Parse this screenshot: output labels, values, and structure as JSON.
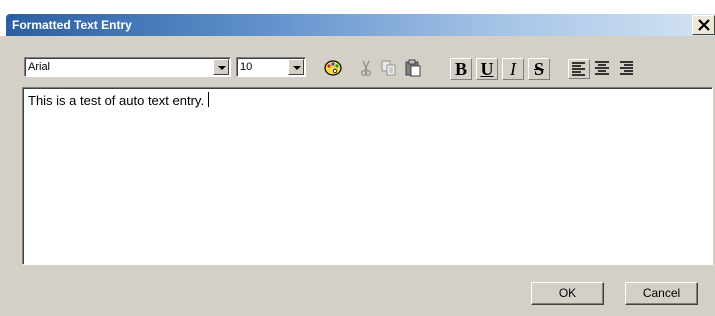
{
  "window": {
    "title": "Formatted Text Entry"
  },
  "toolbar": {
    "font_family": "Arial",
    "font_size": "10",
    "color_icon": "palette-icon",
    "cut_icon": "scissors-icon",
    "copy_icon": "copy-icon",
    "paste_icon": "paste-icon",
    "bold_label": "B",
    "underline_label": "U",
    "italic_label": "I",
    "strike_label": "S",
    "align_left_icon": "align-left-icon",
    "align_center_icon": "align-center-icon",
    "align_right_icon": "align-right-icon"
  },
  "editor": {
    "text": "This is a test of auto text entry."
  },
  "buttons": {
    "ok_label": "OK",
    "cancel_label": "Cancel"
  },
  "colors": {
    "title_bar": "#2a5ea0",
    "dialog_face": "#d4d0c8"
  }
}
